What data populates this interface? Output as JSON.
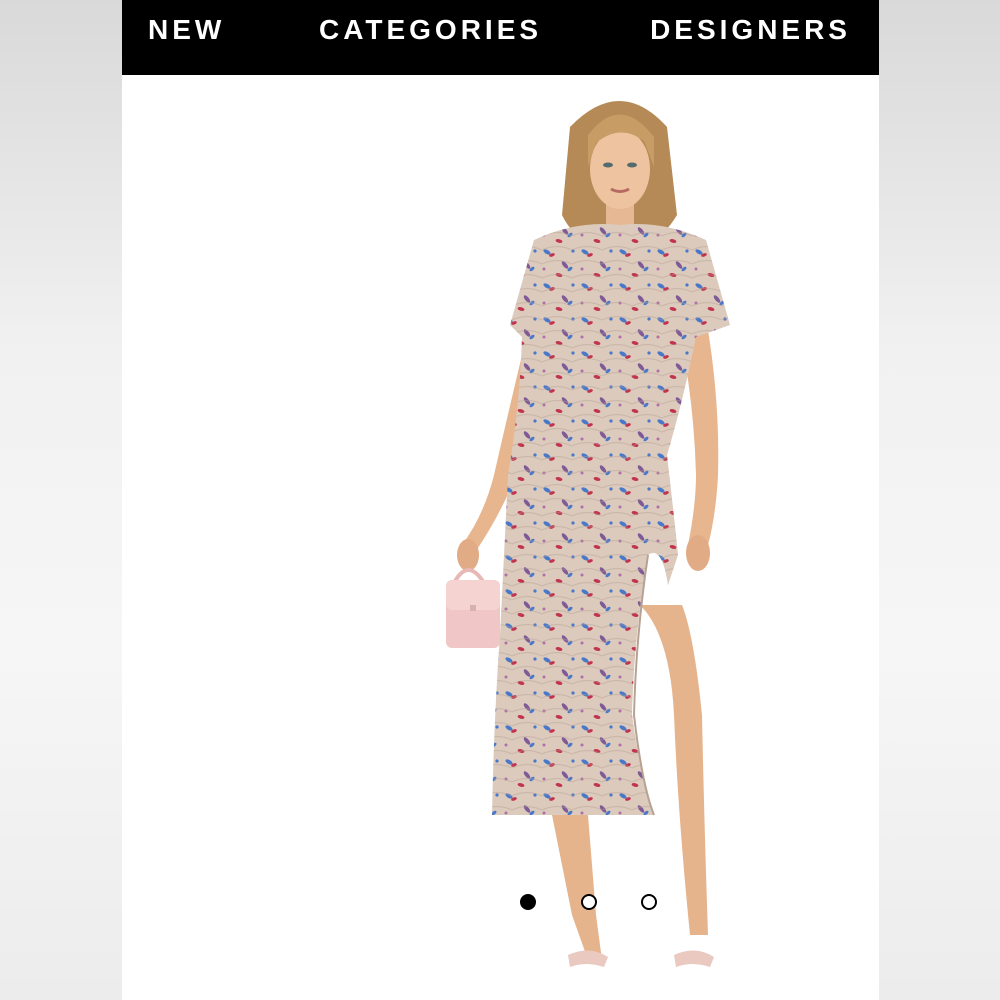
{
  "nav": {
    "items": [
      {
        "label": "NEW"
      },
      {
        "label": "CATEGORIES"
      },
      {
        "label": "DESIGNERS"
      }
    ]
  },
  "product_image": {
    "subject": "model-wearing-floral-ruched-midi-dress",
    "dress_color": "#dccbbd",
    "print_colors": [
      "#4a78c9",
      "#c2334d",
      "#7f5a97"
    ],
    "bag_color": "#f0c7c6"
  },
  "carousel": {
    "slide_count": 3,
    "active_index": 0
  }
}
